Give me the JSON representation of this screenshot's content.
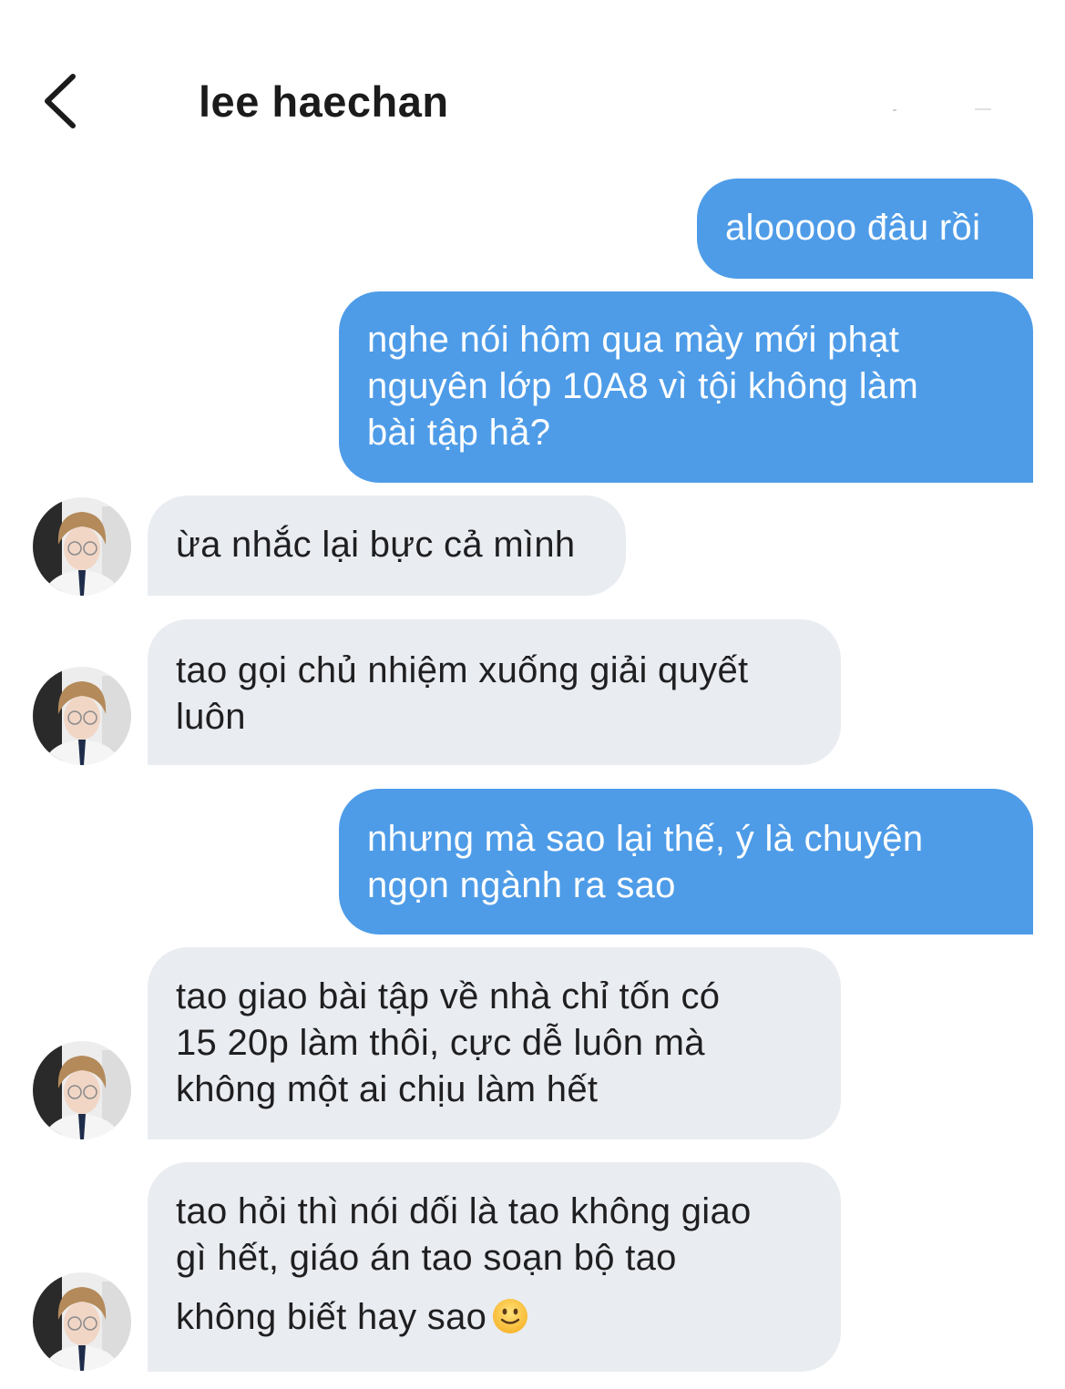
{
  "header": {
    "title": "lee haechan",
    "back_icon": "chevron-left-icon"
  },
  "colors": {
    "outgoing_bubble": "#4e9ce8",
    "incoming_bubble": "#e9ecf0",
    "outgoing_text": "#ffffff",
    "incoming_text": "#1f1f21"
  },
  "messages": [
    {
      "direction": "outgoing",
      "lines": [
        "alooooo đâu rồi"
      ]
    },
    {
      "direction": "outgoing",
      "lines": [
        "nghe nói hôm qua mày mới phạt",
        "nguyên lớp 10A8 vì tội không làm",
        "bài tập hả?"
      ]
    },
    {
      "direction": "incoming",
      "lines": [
        "ừa nhắc lại bực cả mình"
      ]
    },
    {
      "direction": "incoming",
      "lines": [
        "tao gọi chủ nhiệm xuống giải quyết",
        "luôn"
      ]
    },
    {
      "direction": "outgoing",
      "lines": [
        "nhưng mà sao lại thế, ý là chuyện",
        "ngọn ngành ra sao"
      ]
    },
    {
      "direction": "incoming",
      "lines": [
        "tao giao bài tập về nhà chỉ tốn có",
        "15 20p làm thôi, cực dễ luôn mà",
        "không một ai chịu làm hết"
      ]
    },
    {
      "direction": "incoming",
      "lines": [
        "tao hỏi thì nói dối là tao không giao",
        "gì hết, giáo án tao soạn bộ tao",
        "không biết hay sao"
      ],
      "emoji": "slightly-smiling-face-icon"
    }
  ]
}
